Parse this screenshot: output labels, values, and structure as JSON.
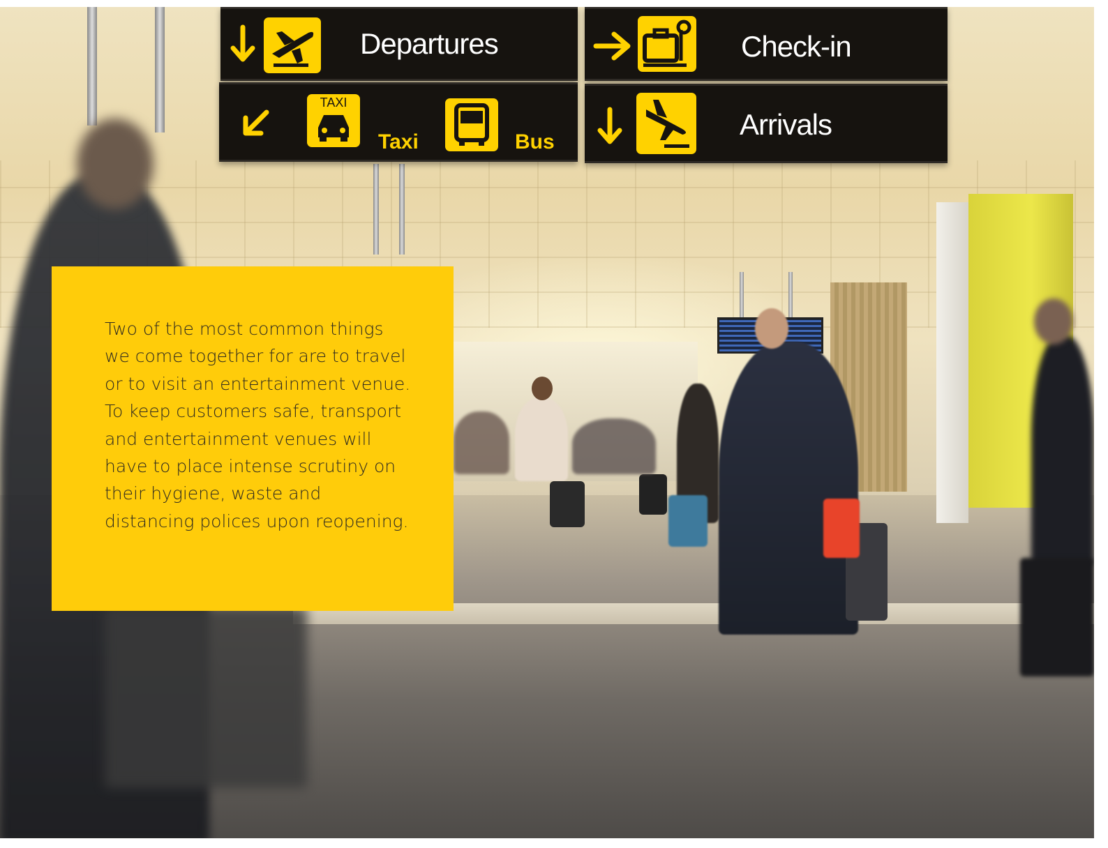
{
  "signs": {
    "departures": "Departures",
    "check_in": "Check-in",
    "taxi_badge": "TAXI",
    "taxi": "Taxi",
    "bus": "Bus",
    "arrivals": "Arrivals"
  },
  "panel": {
    "text": "Two of the most common things we come together for are to travel or to visit an entertainment venue. To keep customers safe, transport and entertainment venues will have to place intense scrutiny on their hygiene, waste and distancing polices upon reopening."
  },
  "colors": {
    "panel_yellow": "#ffcc0a",
    "sign_yellow": "#ffd200",
    "sign_black": "#16130f"
  },
  "icons": [
    "down-arrow-icon",
    "right-arrow-icon",
    "down-left-arrow-icon",
    "departing-plane-icon",
    "luggage-icon",
    "taxi-icon",
    "bus-icon",
    "arriving-plane-icon"
  ]
}
